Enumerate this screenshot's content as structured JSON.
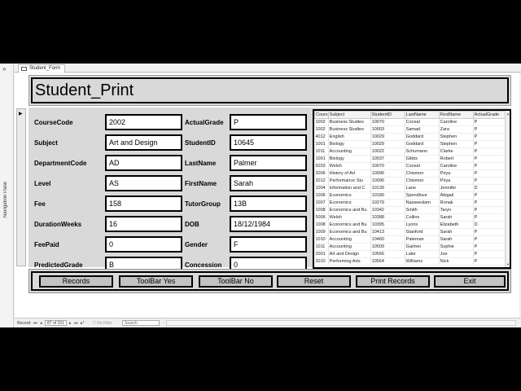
{
  "nav": {
    "chevron": "»",
    "label": "Navigation Pane"
  },
  "tab": {
    "label": "Student_Form"
  },
  "form": {
    "title": "Student_Print",
    "selector_arrow": "▶"
  },
  "fields": [
    {
      "label": "CourseCode",
      "value": "2002"
    },
    {
      "label": "Subject",
      "value": "Art and Design"
    },
    {
      "label": "DepartmentCode",
      "value": "AD"
    },
    {
      "label": "Level",
      "value": "AS"
    },
    {
      "label": "Fee",
      "value": "158"
    },
    {
      "label": "DurationWeeks",
      "value": "16"
    },
    {
      "label": "FeePaid",
      "value": "0"
    },
    {
      "label": "PredictedGrade",
      "value": "B"
    },
    {
      "label": "ActualGrade",
      "value": "P"
    },
    {
      "label": "StudentID",
      "value": "10645"
    },
    {
      "label": "LastName",
      "value": "Palmer"
    },
    {
      "label": "FirstName",
      "value": "Sarah"
    },
    {
      "label": "TutorGroup",
      "value": "13B"
    },
    {
      "label": "DOB",
      "value": "18/12/1984"
    },
    {
      "label": "Gender",
      "value": "F"
    },
    {
      "label": "Concession",
      "value": "0"
    }
  ],
  "datasheet": {
    "columns": [
      "Cours",
      "Subject",
      "StudentID",
      "LastName",
      "FirstName",
      "ActualGrade"
    ],
    "rows": [
      [
        "1002",
        "Business Studies",
        "10070",
        "Coceal",
        "Caroline",
        "P"
      ],
      [
        "1002",
        "Business Studies",
        "10003",
        "Samad",
        "Zara",
        "P"
      ],
      [
        "4012",
        "English",
        "10029",
        "Goddard",
        "Stephen",
        "P"
      ],
      [
        "1001",
        "Biology",
        "10029",
        "Goddard",
        "Stephen",
        "P"
      ],
      [
        "1011",
        "Accounting",
        "10022",
        "Schumann",
        "Clarke",
        "P"
      ],
      [
        "1001",
        "Biology",
        "10037",
        "Gibbs",
        "Robert",
        "P"
      ],
      [
        "5033",
        "Welsh",
        "10070",
        "Coceal",
        "Caroline",
        "P"
      ],
      [
        "2006",
        "History of Art",
        "10096",
        "Chismon",
        "Priya",
        "P"
      ],
      [
        "2012",
        "Performance Stu",
        "10096",
        "Chismon",
        "Priya",
        "P"
      ],
      [
        "1004",
        "Information and C",
        "10139",
        "Lane",
        "Jennifer",
        "D"
      ],
      [
        "1006",
        "Economics",
        "10180",
        "Spendlove",
        "Abigail",
        "P"
      ],
      [
        "1007",
        "Economics",
        "10279",
        "Nasseeslam",
        "Ronak",
        "P"
      ],
      [
        "1008",
        "Economics and Bu",
        "10342",
        "Smith",
        "Taryn",
        "P"
      ],
      [
        "5006",
        "Welsh",
        "10388",
        "Collins",
        "Sarah",
        "P"
      ],
      [
        "1008",
        "Economics and Bu",
        "10395",
        "Lyons",
        "Elizabeth",
        "D"
      ],
      [
        "1009",
        "Economics and Bu",
        "10413",
        "Stanford",
        "Sarah",
        "P"
      ],
      [
        "1010",
        "Accounting",
        "10460",
        "Pateman",
        "Sarah",
        "P"
      ],
      [
        "1011",
        "Accounting",
        "10509",
        "Gartner",
        "Sophie",
        "P"
      ],
      [
        "2001",
        "Art and Design",
        "10566",
        "Lake",
        "Joe",
        "P"
      ],
      [
        "2010",
        "Performing Arts",
        "10564",
        "Williams",
        "Nick",
        "P"
      ]
    ]
  },
  "buttons": [
    "Records",
    "ToolBar Yes",
    "ToolBar No",
    "Reset",
    "Print Records",
    "Exit"
  ],
  "recordbar": {
    "record_label": "Record:",
    "position": "87 of 151",
    "filter": "No Filter",
    "search": "Search",
    "nav_first": "⏮",
    "nav_prev": "◂",
    "nav_next": "▸",
    "nav_last": "⏭",
    "nav_new": "▸*"
  }
}
